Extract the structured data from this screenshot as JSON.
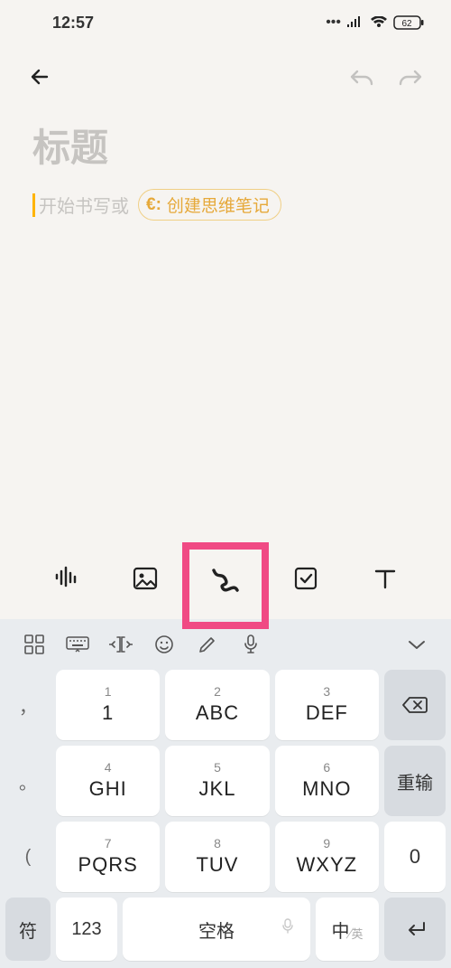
{
  "status": {
    "time": "12:57",
    "battery": "62"
  },
  "title_placeholder": "标题",
  "body_placeholder": "开始书写或",
  "chip": {
    "icon": "€:",
    "label": "创建思维笔记"
  },
  "tools": [
    "voice",
    "image",
    "scribble",
    "checkbox",
    "text"
  ],
  "kbd": {
    "rows": [
      [
        {
          "num": "1",
          "main": "1"
        },
        {
          "num": "2",
          "main": "ABC"
        },
        {
          "num": "3",
          "main": "DEF"
        }
      ],
      [
        {
          "num": "4",
          "main": "GHI"
        },
        {
          "num": "5",
          "main": "JKL"
        },
        {
          "num": "6",
          "main": "MNO"
        }
      ],
      [
        {
          "num": "7",
          "main": "PQRS"
        },
        {
          "num": "8",
          "main": "TUV"
        },
        {
          "num": "9",
          "main": "WXYZ"
        }
      ]
    ],
    "side_syms": [
      "，",
      "。",
      "("
    ],
    "right": [
      "⌫",
      "重输",
      "0"
    ],
    "bottom": {
      "sym": "符",
      "num": "123",
      "space": "空格",
      "lang_main": "中",
      "lang_sub": "英"
    }
  }
}
